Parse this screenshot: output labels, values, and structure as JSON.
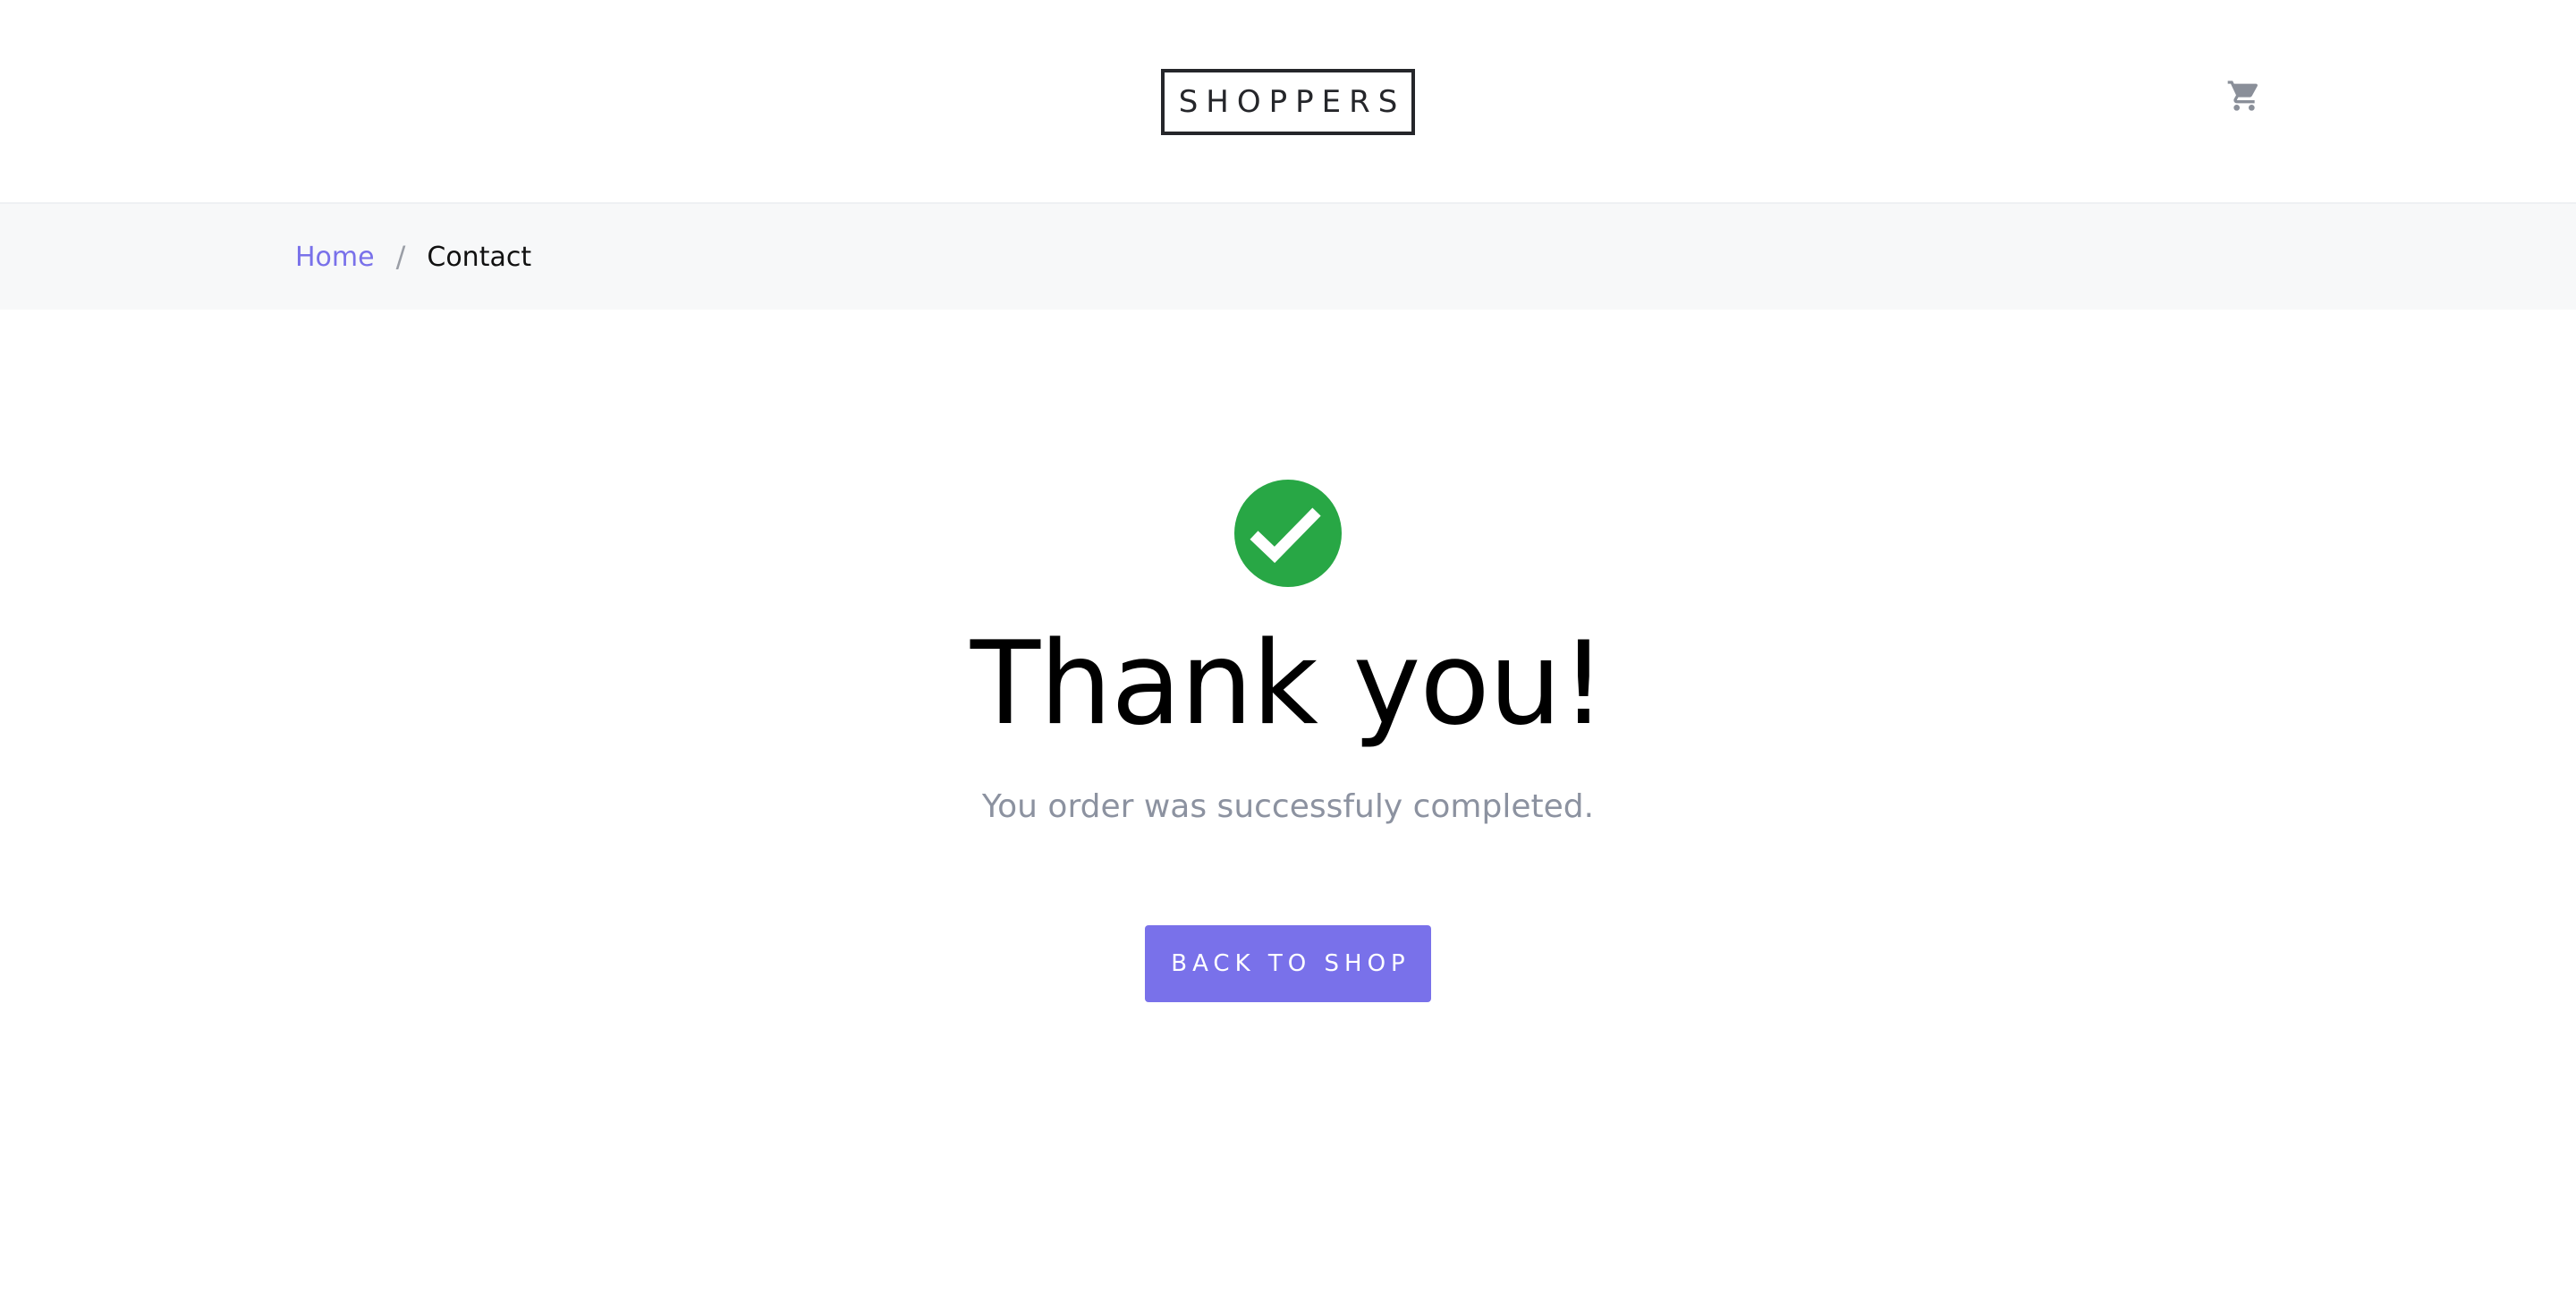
{
  "header": {
    "logo_text": "SHOPPERS",
    "cart_icon": "cart-icon"
  },
  "breadcrumb": {
    "home_label": "Home",
    "separator": "/",
    "current_label": "Contact"
  },
  "confirmation": {
    "icon": "check-circle-icon",
    "title": "Thank you!",
    "message": "You order was successfuly completed.",
    "button_label": "BACK TO SHOP"
  },
  "colors": {
    "accent": "#7971ea",
    "success": "#28a745",
    "muted_text": "#8c92a0",
    "breadcrumb_bg": "#f7f8f9",
    "cart_icon": "#8a8f99"
  }
}
